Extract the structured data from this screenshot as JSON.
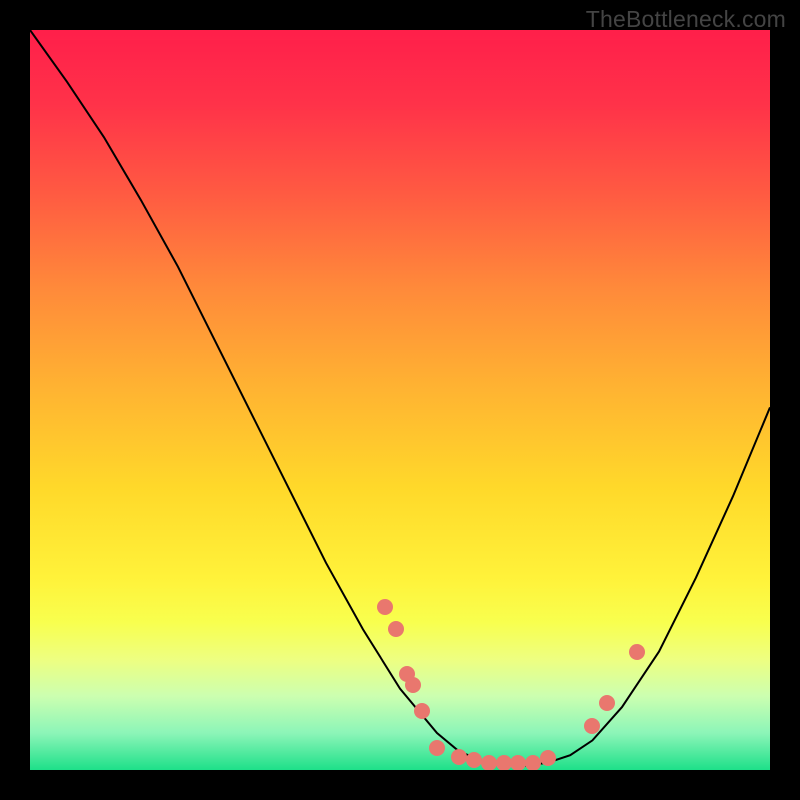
{
  "chart_data": {
    "type": "line",
    "watermark": "TheBottleneck.com",
    "title": "",
    "xlabel": "",
    "ylabel": "",
    "xlim": [
      0,
      100
    ],
    "ylim": [
      0,
      100
    ],
    "curve": [
      {
        "x": 0.0,
        "y": 100.0
      },
      {
        "x": 5.0,
        "y": 93.0
      },
      {
        "x": 10.0,
        "y": 85.5
      },
      {
        "x": 15.0,
        "y": 77.0
      },
      {
        "x": 20.0,
        "y": 68.0
      },
      {
        "x": 25.0,
        "y": 58.0
      },
      {
        "x": 30.0,
        "y": 48.0
      },
      {
        "x": 35.0,
        "y": 38.0
      },
      {
        "x": 40.0,
        "y": 28.0
      },
      {
        "x": 45.0,
        "y": 19.0
      },
      {
        "x": 50.0,
        "y": 11.0
      },
      {
        "x": 55.0,
        "y": 5.0
      },
      {
        "x": 58.0,
        "y": 2.5
      },
      {
        "x": 61.0,
        "y": 1.3
      },
      {
        "x": 64.0,
        "y": 0.7
      },
      {
        "x": 67.0,
        "y": 0.6
      },
      {
        "x": 70.0,
        "y": 1.0
      },
      {
        "x": 73.0,
        "y": 2.0
      },
      {
        "x": 76.0,
        "y": 4.0
      },
      {
        "x": 80.0,
        "y": 8.5
      },
      {
        "x": 85.0,
        "y": 16.0
      },
      {
        "x": 90.0,
        "y": 26.0
      },
      {
        "x": 95.0,
        "y": 37.0
      },
      {
        "x": 100.0,
        "y": 49.0
      }
    ],
    "markers": [
      {
        "x": 48.0,
        "y": 22.0
      },
      {
        "x": 49.5,
        "y": 19.0
      },
      {
        "x": 51.0,
        "y": 13.0
      },
      {
        "x": 51.8,
        "y": 11.5
      },
      {
        "x": 53.0,
        "y": 8.0
      },
      {
        "x": 55.0,
        "y": 3.0
      },
      {
        "x": 58.0,
        "y": 1.8
      },
      {
        "x": 60.0,
        "y": 1.3
      },
      {
        "x": 62.0,
        "y": 1.0
      },
      {
        "x": 64.0,
        "y": 0.9
      },
      {
        "x": 66.0,
        "y": 0.9
      },
      {
        "x": 68.0,
        "y": 1.0
      },
      {
        "x": 70.0,
        "y": 1.6
      },
      {
        "x": 76.0,
        "y": 6.0
      },
      {
        "x": 78.0,
        "y": 9.0
      },
      {
        "x": 82.0,
        "y": 16.0
      }
    ],
    "marker_color": "#e9776e",
    "curve_color": "#000000"
  }
}
